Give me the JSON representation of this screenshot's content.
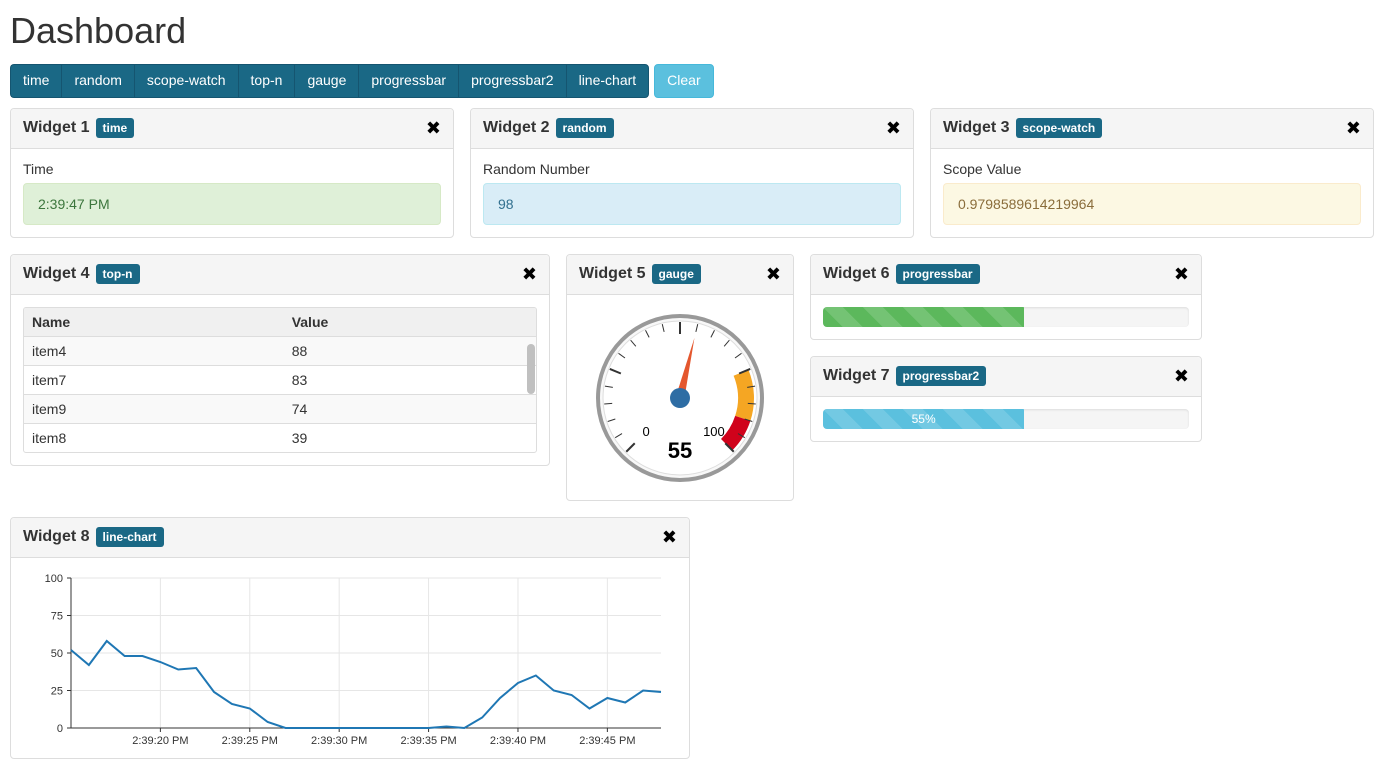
{
  "page_title": "Dashboard",
  "toolbar": {
    "buttons": [
      "time",
      "random",
      "scope-watch",
      "top-n",
      "gauge",
      "progressbar",
      "progressbar2",
      "line-chart"
    ],
    "clear_label": "Clear"
  },
  "widgets": {
    "w1": {
      "title": "Widget 1",
      "badge": "time",
      "field_label": "Time",
      "value": "2:39:47 PM"
    },
    "w2": {
      "title": "Widget 2",
      "badge": "random",
      "field_label": "Random Number",
      "value": "98"
    },
    "w3": {
      "title": "Widget 3",
      "badge": "scope-watch",
      "field_label": "Scope Value",
      "value": "0.9798589614219964"
    },
    "w4": {
      "title": "Widget 4",
      "badge": "top-n",
      "columns": [
        "Name",
        "Value"
      ],
      "rows": [
        {
          "name": "item4",
          "value": "88"
        },
        {
          "name": "item7",
          "value": "83"
        },
        {
          "name": "item9",
          "value": "74"
        },
        {
          "name": "item8",
          "value": "39"
        }
      ]
    },
    "w5": {
      "title": "Widget 5",
      "badge": "gauge",
      "value": 55,
      "min": 0,
      "max": 100
    },
    "w6": {
      "title": "Widget 6",
      "badge": "progressbar",
      "percent": 55
    },
    "w7": {
      "title": "Widget 7",
      "badge": "progressbar2",
      "percent": 55,
      "label": "55%"
    },
    "w8": {
      "title": "Widget 8",
      "badge": "line-chart"
    }
  },
  "chart_data": {
    "type": "line",
    "title": "",
    "xlabel": "",
    "ylabel": "",
    "ylim": [
      0,
      100
    ],
    "yticks": [
      0,
      25,
      50,
      75,
      100
    ],
    "xticks": [
      "2:39:20 PM",
      "2:39:25 PM",
      "2:39:30 PM",
      "2:39:35 PM",
      "2:39:40 PM",
      "2:39:45 PM"
    ],
    "x": [
      15,
      16,
      17,
      18,
      19,
      20,
      21,
      22,
      23,
      24,
      25,
      26,
      27,
      28,
      29,
      30,
      31,
      32,
      33,
      34,
      35,
      36,
      37,
      38,
      39,
      40,
      41,
      42,
      43,
      44,
      45,
      46,
      47,
      48
    ],
    "values": [
      52,
      42,
      58,
      48,
      48,
      44,
      39,
      40,
      24,
      16,
      13,
      4,
      0,
      0,
      0,
      0,
      0,
      0,
      0,
      0,
      0,
      1,
      0,
      7,
      20,
      30,
      35,
      25,
      22,
      13,
      20,
      17,
      25,
      24
    ]
  }
}
